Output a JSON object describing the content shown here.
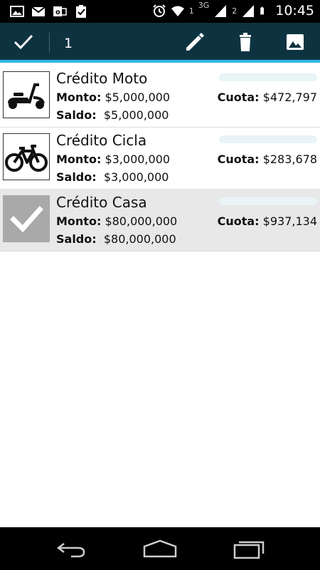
{
  "status_bar": {
    "time": "10:45",
    "network": "3G",
    "sim1": "1",
    "sim2": "2",
    "icons": [
      "image-icon",
      "mail-icon",
      "outlook-icon",
      "clipboard-check-icon",
      "alarm-icon",
      "wifi-icon",
      "signal-icon",
      "battery-icon"
    ]
  },
  "action_bar": {
    "selected_count": "1",
    "icons": [
      "check-done-icon",
      "pencil-icon",
      "trash-icon",
      "picture-icon"
    ],
    "accent_color": "#33b5e5",
    "background_color": "#0e3340"
  },
  "credits": [
    {
      "title": "Crédito Moto",
      "monto_label": "Monto:",
      "monto": "$5,000,000",
      "saldo_label": "Saldo:",
      "saldo": "$5,000,000",
      "cuota_label": "Cuota:",
      "cuota": "$472,797",
      "progress": 0,
      "icon": "scooter-icon",
      "selected": false
    },
    {
      "title": "Crédito Cicla",
      "monto_label": "Monto:",
      "monto": "$3,000,000",
      "saldo_label": "Saldo:",
      "saldo": "$3,000,000",
      "cuota_label": "Cuota:",
      "cuota": "$283,678",
      "progress": 0,
      "icon": "bicycle-icon",
      "selected": false
    },
    {
      "title": "Crédito Casa",
      "monto_label": "Monto:",
      "monto": "$80,000,000",
      "saldo_label": "Saldo:",
      "saldo": "$80,000,000",
      "cuota_label": "Cuota:",
      "cuota": "$937,134",
      "progress": 0,
      "icon": "checkmark-icon",
      "selected": true
    }
  ],
  "nav_bar": {
    "icons": [
      "back-icon",
      "home-icon",
      "recents-icon"
    ]
  }
}
